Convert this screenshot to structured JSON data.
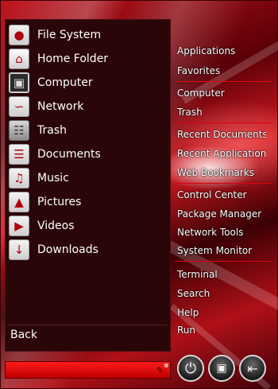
{
  "places": [
    {
      "label": "File System",
      "icon": "file-system-icon"
    },
    {
      "label": "Home Folder",
      "icon": "home-folder-icon"
    },
    {
      "label": "Computer",
      "icon": "computer-icon"
    },
    {
      "label": "Network",
      "icon": "network-icon"
    },
    {
      "label": "Trash",
      "icon": "trash-icon"
    },
    {
      "label": "Documents",
      "icon": "documents-icon"
    },
    {
      "label": "Music",
      "icon": "music-icon"
    },
    {
      "label": "Pictures",
      "icon": "pictures-icon"
    },
    {
      "label": "Videos",
      "icon": "videos-icon"
    },
    {
      "label": "Downloads",
      "icon": "downloads-icon"
    }
  ],
  "back_label": "Back",
  "menu": {
    "applications": "Applications",
    "favorites": "Favorites",
    "computer": "Computer",
    "trash": "Trash",
    "recent_documents": "Recent Documents",
    "recent_applications": "Recent Applications",
    "web_bookmarks": "Web Bookmarks",
    "control_center": "Control Center",
    "package_manager": "Package Manager",
    "network_tools": "Network Tools",
    "system_monitor": "System Monitor",
    "terminal": "Terminal",
    "search": "Search",
    "help": "Help",
    "run": "Run"
  },
  "buttons": {
    "power": "power-icon",
    "lock": "lock-icon",
    "logout": "logout-icon"
  },
  "colors": {
    "accent": "#e00010",
    "panel": "#2a0609",
    "search_bar": "#e00000"
  }
}
